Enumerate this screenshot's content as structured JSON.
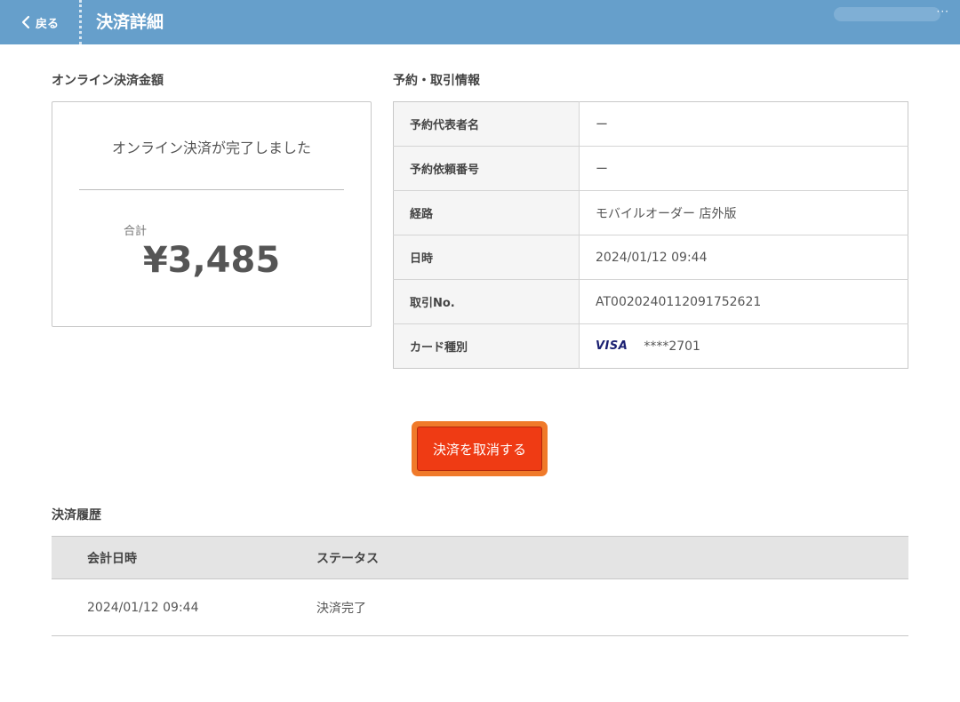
{
  "header": {
    "back_label": "戻る",
    "title": "決済詳細",
    "more": "···"
  },
  "amount_section": {
    "label": "オンライン決済金額",
    "message": "オンライン決済が完了しました",
    "total_label": "合計",
    "total_value": "¥3,485"
  },
  "info_section": {
    "label": "予約・取引情報",
    "rows": [
      {
        "key": "予約代表者名",
        "value": "ー"
      },
      {
        "key": "予約依頼番号",
        "value": "ー"
      },
      {
        "key": "経路",
        "value": "モバイルオーダー 店外版"
      },
      {
        "key": "日時",
        "value": "2024/01/12 09:44"
      },
      {
        "key": "取引No.",
        "value": "AT0020240112091752621"
      },
      {
        "key": "カード種別",
        "brand": "VISA",
        "value": "****2701"
      }
    ]
  },
  "cancel_button": {
    "label": "決済を取消する"
  },
  "history": {
    "label": "決済履歴",
    "columns": [
      "会計日時",
      "ステータス"
    ],
    "rows": [
      {
        "date": "2024/01/12 09:44",
        "status": "決済完了"
      }
    ]
  },
  "colors": {
    "header_bg": "#669fcb",
    "cancel_bg": "#ef3b14",
    "cancel_outline": "#f07a2a"
  }
}
